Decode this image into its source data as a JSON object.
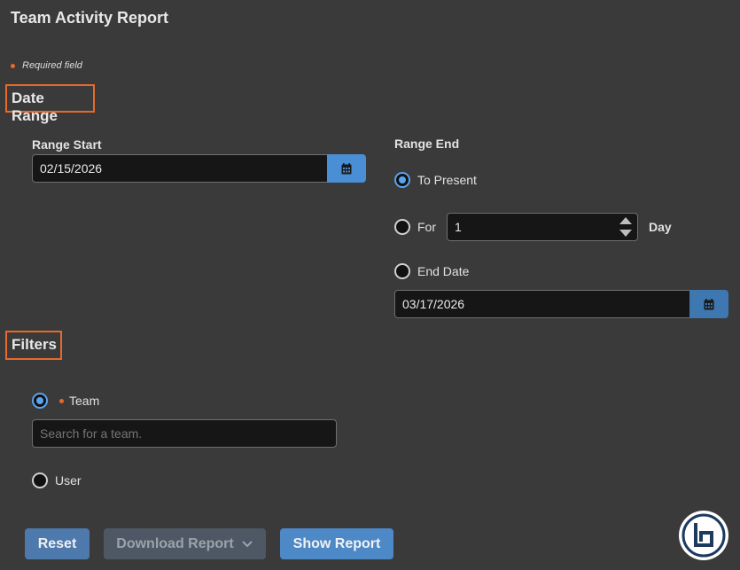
{
  "page": {
    "title": "Team Activity Report",
    "required_note": "Required field"
  },
  "date_range": {
    "heading": "Date Range",
    "start_label": "Range Start",
    "start_value": "02/15/2026",
    "end_label": "Range End",
    "options": {
      "to_present": "To Present",
      "for": "For",
      "for_value": "1",
      "for_unit": "Day",
      "end_date": "End Date",
      "end_date_value": "03/17/2026"
    }
  },
  "filters": {
    "heading": "Filters",
    "team_label": "Team",
    "team_search_placeholder": "Search for a team.",
    "user_label": "User"
  },
  "actions": {
    "reset": "Reset",
    "download": "Download Report",
    "show": "Show Report"
  },
  "colors": {
    "accent_orange": "#e8692a",
    "primary_blue": "#4d88c7",
    "background": "#3a3a3a"
  }
}
